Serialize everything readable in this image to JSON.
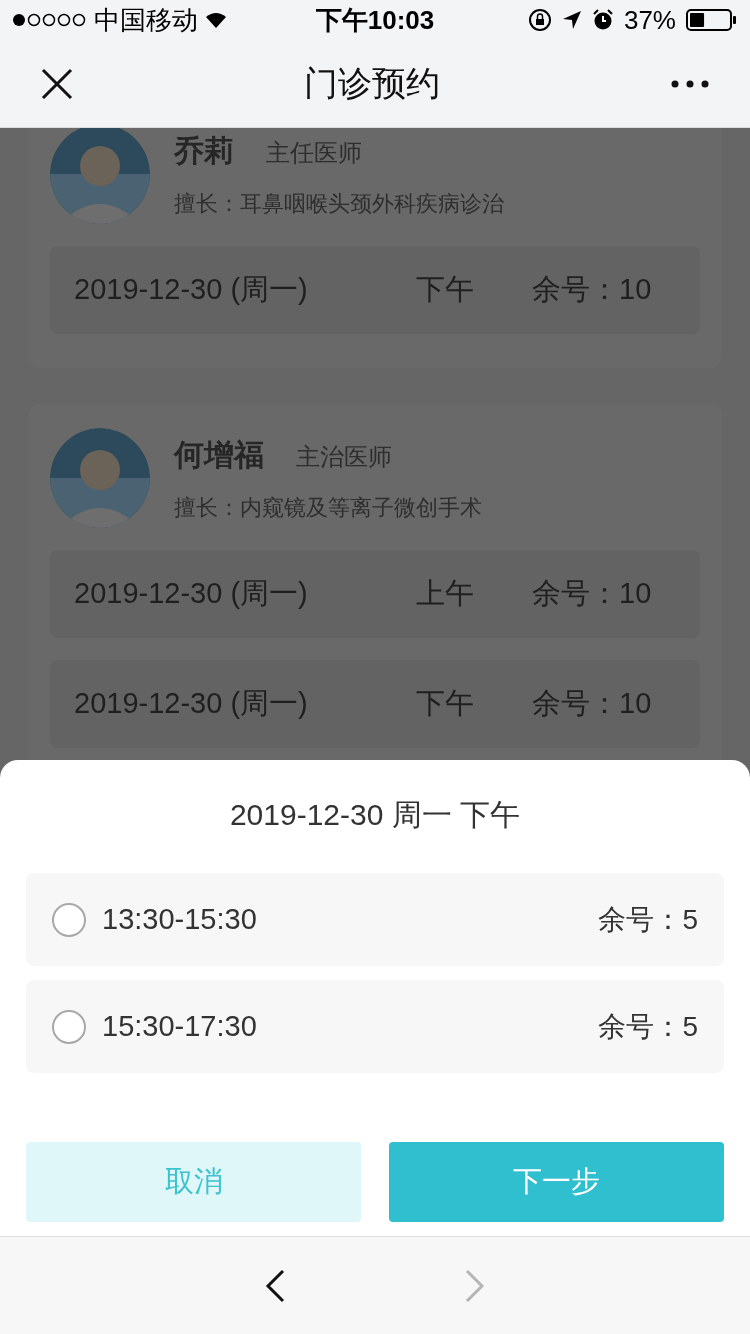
{
  "status_bar": {
    "carrier": "中国移动",
    "time": "下午10:03",
    "battery": "37%"
  },
  "nav": {
    "title": "门诊预约"
  },
  "doctors": [
    {
      "name": "乔莉",
      "title": "主任医师",
      "specialty": "擅长：耳鼻咽喉头颈外科疾病诊治",
      "slots": [
        {
          "date": "2019-12-30 (周一)",
          "period": "下午",
          "remaining": "余号：10"
        }
      ]
    },
    {
      "name": "何增福",
      "title": "主治医师",
      "specialty": "擅长：内窥镜及等离子微创手术",
      "slots": [
        {
          "date": "2019-12-30 (周一)",
          "period": "上午",
          "remaining": "余号：10"
        },
        {
          "date": "2019-12-30 (周一)",
          "period": "下午",
          "remaining": "余号：10"
        }
      ]
    }
  ],
  "sheet": {
    "heading": "2019-12-30 周一 下午",
    "options": [
      {
        "time": "13:30-15:30",
        "remaining": "余号：5",
        "selected": false
      },
      {
        "time": "15:30-17:30",
        "remaining": "余号：5",
        "selected": false
      }
    ],
    "cancel": "取消",
    "next": "下一步"
  },
  "toolbar": {
    "back_disabled": false,
    "forward_disabled": true
  }
}
